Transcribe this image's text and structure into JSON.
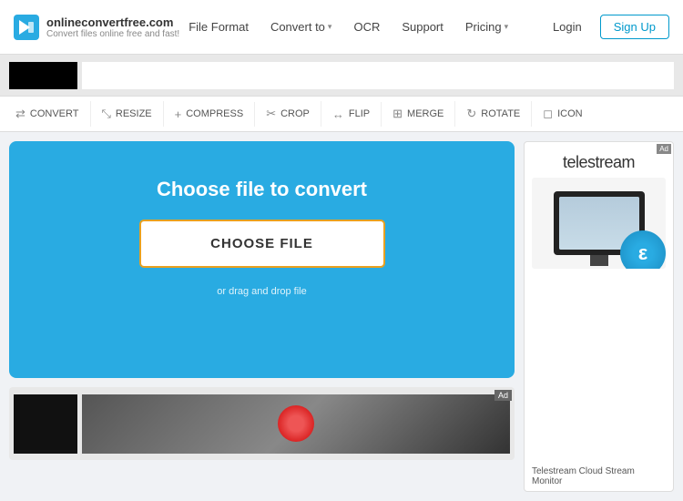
{
  "header": {
    "logo_title": "onlineconvertfree.com",
    "logo_subtitle": "Convert files online free and fast!",
    "nav": [
      {
        "label": "File Format",
        "has_arrow": false
      },
      {
        "label": "Convert to",
        "has_arrow": true
      },
      {
        "label": "OCR",
        "has_arrow": false
      },
      {
        "label": "Support",
        "has_arrow": false
      },
      {
        "label": "Pricing",
        "has_arrow": true
      }
    ],
    "login_label": "Login",
    "signup_label": "Sign Up"
  },
  "toolbar": {
    "tools": [
      {
        "label": "CONVERT",
        "icon": "⇄"
      },
      {
        "label": "RESIZE",
        "icon": "⤡"
      },
      {
        "label": "COMPRESS",
        "icon": "+"
      },
      {
        "label": "CROP",
        "icon": "✂"
      },
      {
        "label": "FLIP",
        "icon": "↔"
      },
      {
        "label": "MERGE",
        "icon": "⊞"
      },
      {
        "label": "ROTATE",
        "icon": "↻"
      },
      {
        "label": "ICON",
        "icon": "◻"
      }
    ]
  },
  "converter": {
    "title": "Choose file to convert",
    "button_label": "CHOOSE FILE",
    "drag_drop_text": "or drag and drop file"
  },
  "right_ad": {
    "brand": "telestream",
    "bottom_text": "Telestream Cloud Stream Monitor"
  },
  "colors": {
    "primary_blue": "#29abe2",
    "orange_border": "#e8a020"
  }
}
